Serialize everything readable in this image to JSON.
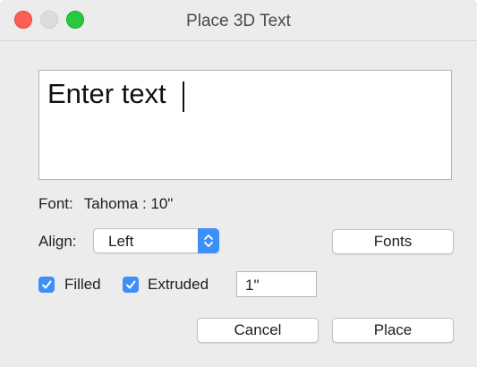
{
  "window": {
    "title": "Place 3D Text",
    "controls": [
      "close",
      "minimize",
      "zoom"
    ]
  },
  "text_input": {
    "value": "Enter text"
  },
  "font": {
    "label": "Font:",
    "value": "Tahoma : 10\""
  },
  "align": {
    "label": "Align:",
    "selected": "Left",
    "stepper_icon": "updown-chevron-icon"
  },
  "buttons": {
    "fonts": "Fonts",
    "cancel": "Cancel",
    "place": "Place"
  },
  "options": {
    "filled": {
      "label": "Filled",
      "checked": true
    },
    "extruded": {
      "label": "Extruded",
      "checked": true
    }
  },
  "depth": {
    "value": "1\""
  },
  "colors": {
    "accent": "#3d8ff7",
    "close": "#fd5f57",
    "zoom": "#28c840",
    "background": "#ececec"
  }
}
